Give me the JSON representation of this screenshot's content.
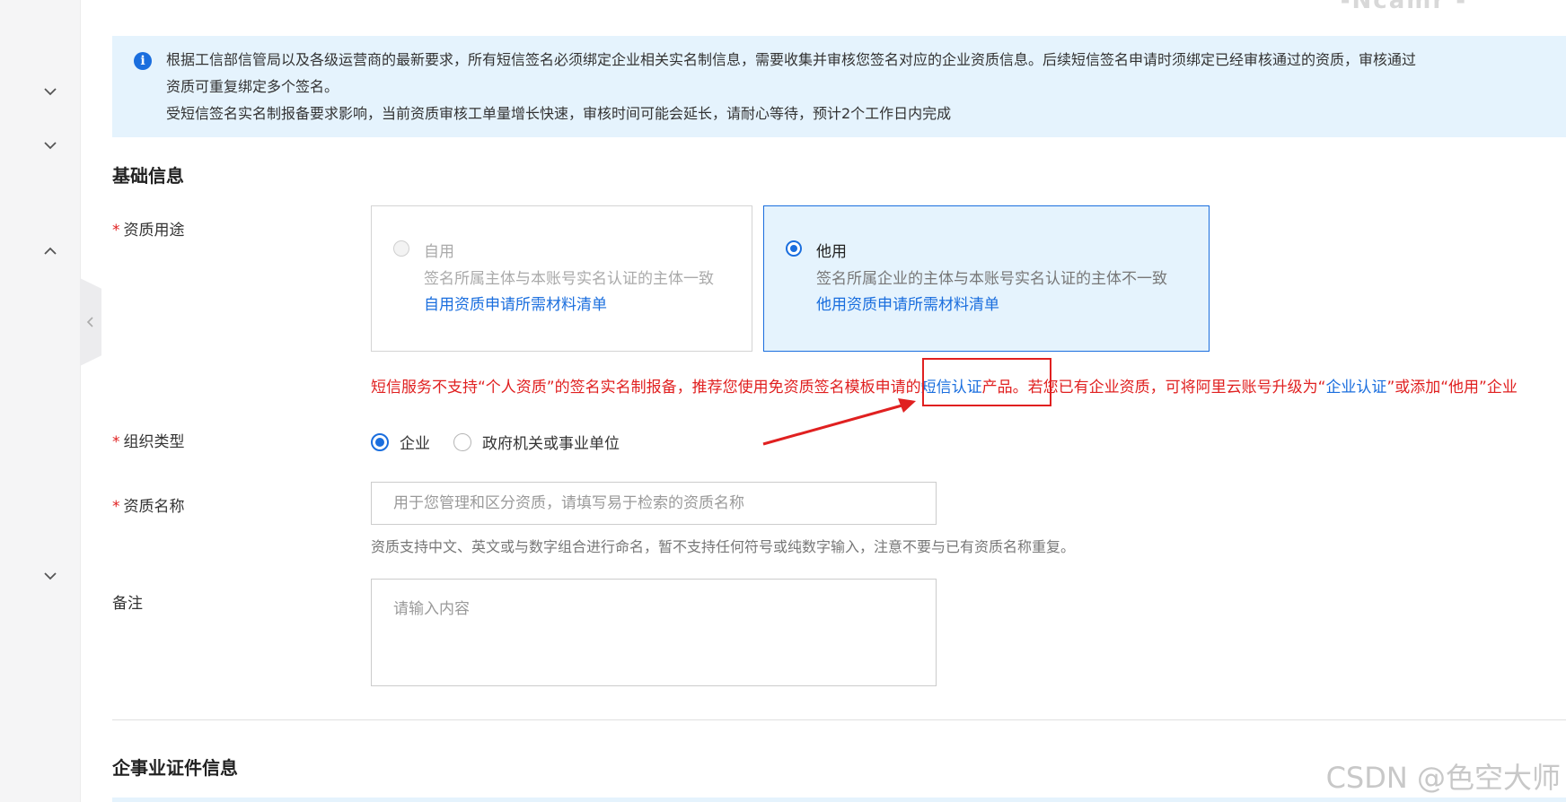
{
  "header": {
    "remnant_text": "-Ncamr -"
  },
  "notice": {
    "line1": "根据工信部信管局以及各级运营商的最新要求，所有短信签名必须绑定企业相关实名制信息，需要收集并审核您签名对应的企业资质信息。后续短信签名申请时须绑定已经审核通过的资质，审核通过",
    "line2": "资质可重复绑定多个签名。",
    "line3": "受短信签名实名制报备要求影响，当前资质审核工单量增长快速，审核时间可能会延长，请耐心等待，预计2个工作日内完成"
  },
  "basic_info": {
    "title": "基础信息",
    "required_mark": "*",
    "usage_label": "资质用途",
    "self_use": {
      "title": "自用",
      "desc": "签名所属主体与本账号实名认证的主体一致",
      "link": "自用资质申请所需材料清单"
    },
    "other_use": {
      "title": "他用",
      "desc": "签名所属企业的主体与本账号实名认证的主体不一致",
      "link": "他用资质申请所需材料清单"
    },
    "warning": {
      "part1": "短信服务不支持“个人资质”的签名实名制报备，推荐您使用免资质签名模板申请的",
      "link1": "短信认证",
      "part2": "产品。若您已有企业资质，可将阿里云账号升级为“",
      "link2": "企业认证",
      "part3": "”或添加“他用”企业"
    },
    "org_type_label": "组织类型",
    "org_options": [
      "企业",
      "政府机关或事业单位"
    ],
    "name_label": "资质名称",
    "name_placeholder": "用于您管理和区分资质，请填写易于检索的资质名称",
    "name_help": "资质支持中文、英文或与数字组合进行命名，暂不支持任何符号或纯数字输入，注意不要与已有资质名称重复。",
    "remark_label": "备注",
    "remark_placeholder": "请输入内容"
  },
  "cert_section": {
    "title": "企事业证件信息"
  },
  "watermark": "CSDN @色空大师",
  "colors": {
    "accent": "#1a6ede",
    "warning": "#e02020",
    "notice_bg": "#e5f3fd"
  },
  "icons": [
    "info-icon",
    "chevron-down-icon",
    "chevron-up-icon",
    "chevron-left-icon"
  ]
}
